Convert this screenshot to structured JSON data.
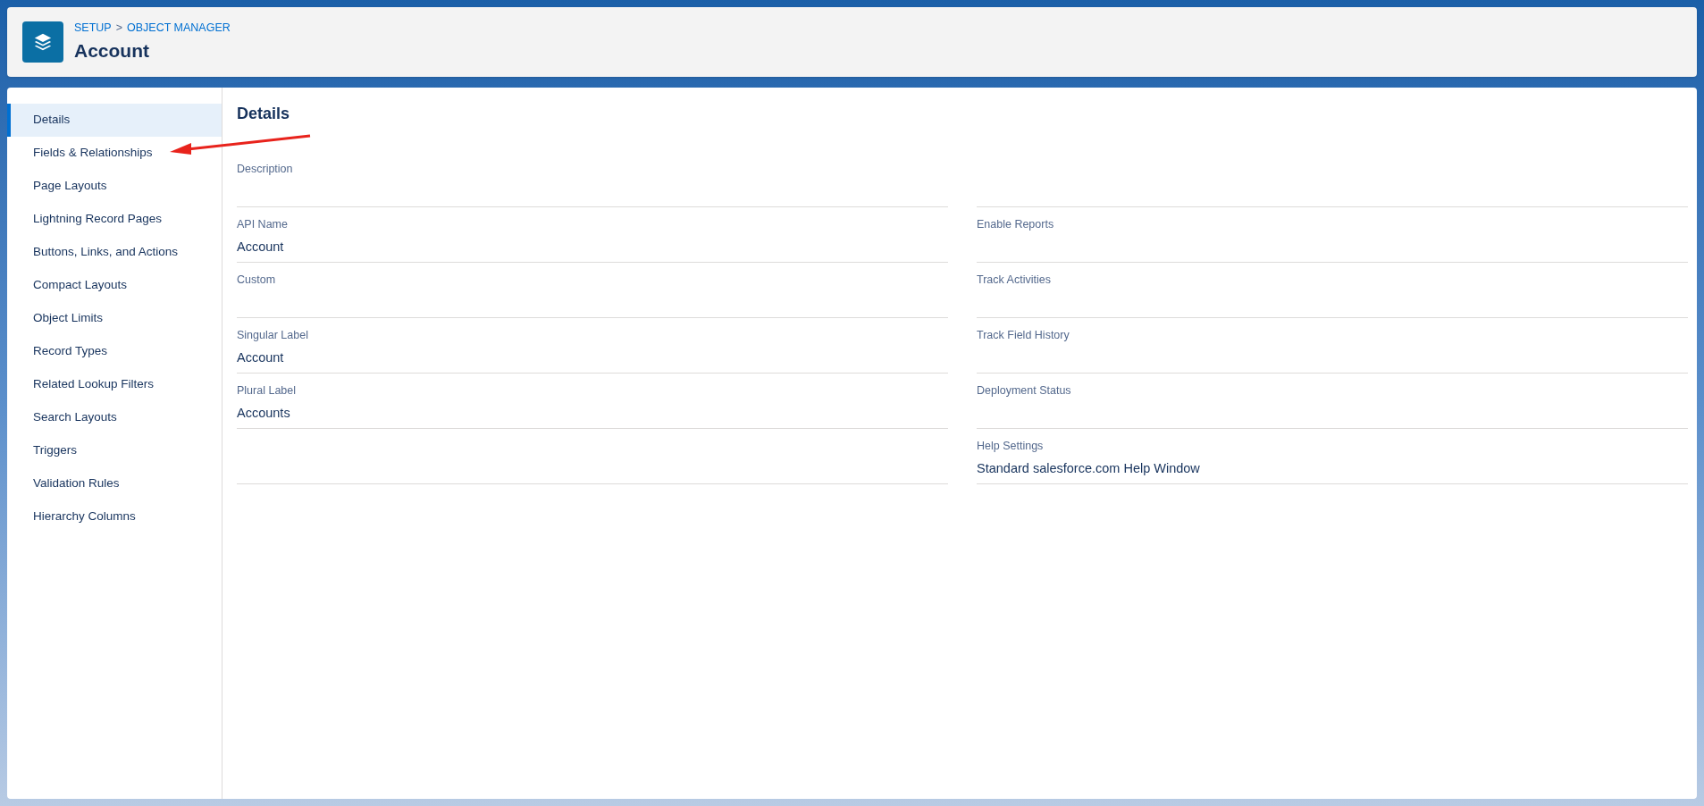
{
  "header": {
    "breadcrumbs": [
      "SETUP",
      ">",
      "OBJECT MANAGER"
    ],
    "title": "Account"
  },
  "sidebar": {
    "items": [
      {
        "label": "Details",
        "selected": true
      },
      {
        "label": "Fields & Relationships",
        "selected": false
      },
      {
        "label": "Page Layouts",
        "selected": false
      },
      {
        "label": "Lightning Record Pages",
        "selected": false
      },
      {
        "label": "Buttons, Links, and Actions",
        "selected": false
      },
      {
        "label": "Compact Layouts",
        "selected": false
      },
      {
        "label": "Object Limits",
        "selected": false
      },
      {
        "label": "Record Types",
        "selected": false
      },
      {
        "label": "Related Lookup Filters",
        "selected": false
      },
      {
        "label": "Search Layouts",
        "selected": false
      },
      {
        "label": "Triggers",
        "selected": false
      },
      {
        "label": "Validation Rules",
        "selected": false
      },
      {
        "label": "Hierarchy Columns",
        "selected": false
      }
    ]
  },
  "details": {
    "title": "Details",
    "rows": [
      {
        "left": {
          "label": "Description"
        },
        "right": null
      },
      {
        "left": {
          "label": "API Name",
          "value": "Account"
        },
        "right": {
          "label": "Enable Reports"
        }
      },
      {
        "left": {
          "label": "Custom"
        },
        "right": {
          "label": "Track Activities"
        }
      },
      {
        "left": {
          "label": "Singular Label",
          "value": "Account"
        },
        "right": {
          "label": "Track Field History"
        }
      },
      {
        "left": {
          "label": "Plural Label",
          "value": "Accounts"
        },
        "right": {
          "label": "Deployment Status"
        }
      },
      {
        "left": null,
        "right": {
          "label": "Help Settings",
          "value": "Standard salesforce.com Help Window"
        }
      }
    ]
  }
}
